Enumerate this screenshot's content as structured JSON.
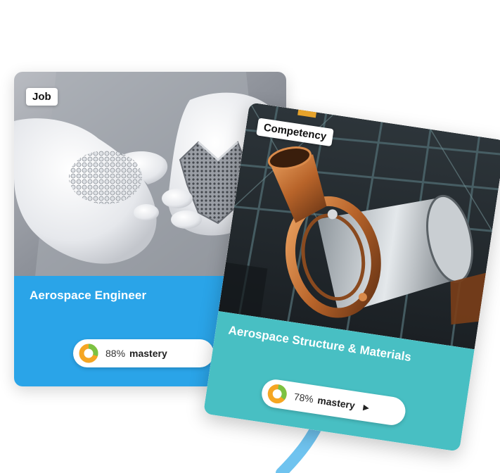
{
  "cards": {
    "job": {
      "badge": "Job",
      "title": "Aerospace Engineer",
      "mastery_percent": "88%",
      "mastery_label": "mastery",
      "mastery_fraction": 0.88,
      "accent": "#2aa4e8"
    },
    "competency": {
      "badge": "Competency",
      "title": "Aerospace Structure & Materials",
      "mastery_percent": "78%",
      "mastery_label": "mastery",
      "mastery_fraction": 0.78,
      "play_icon": "play-icon",
      "accent": "#48bfc3"
    }
  },
  "colors": {
    "donut_orange": "#f5a623",
    "donut_green": "#7cc242",
    "connector": "#6fc3ef"
  }
}
